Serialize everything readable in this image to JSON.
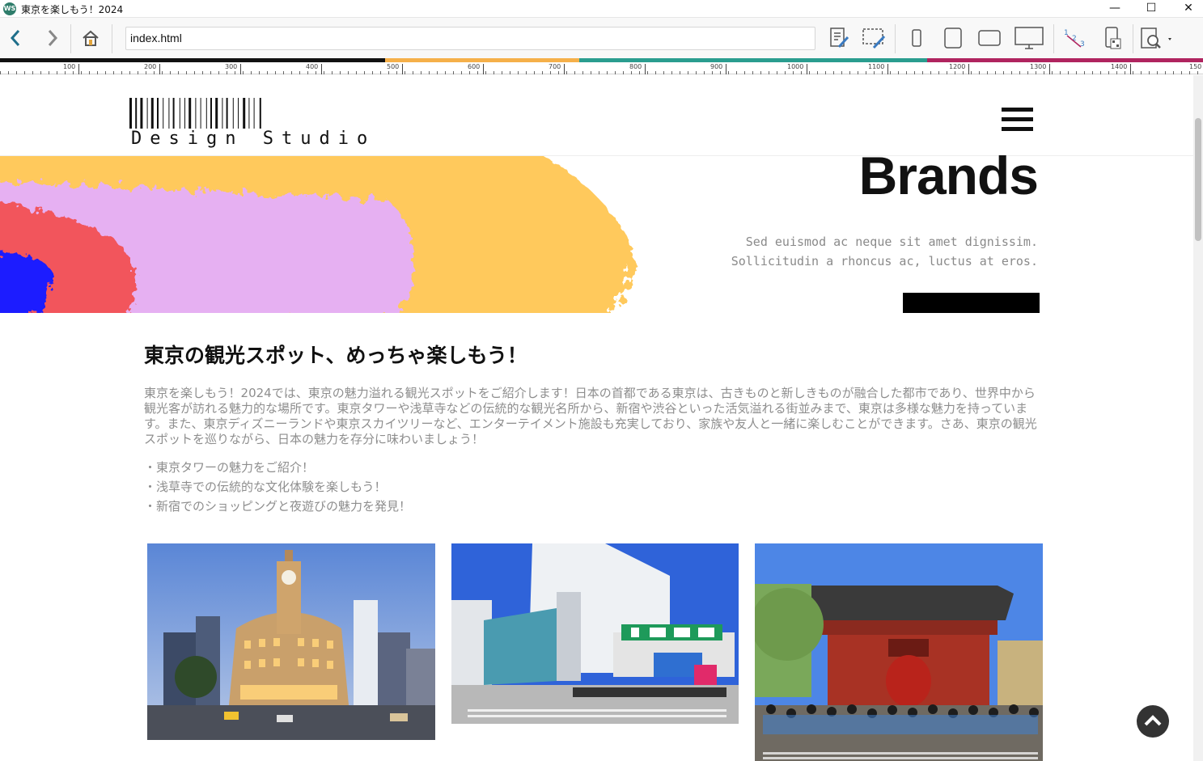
{
  "window": {
    "title": "東京を楽しもう！2024",
    "app_icon_text": "WS",
    "minimize": "—",
    "maximize": "☐",
    "close": "✕"
  },
  "toolbar": {
    "address": "index.html"
  },
  "ruler": {
    "labels": [
      "100",
      "200",
      "300",
      "400",
      "500",
      "600",
      "700",
      "800",
      "900",
      "1000",
      "1100",
      "1200",
      "1300",
      "1400",
      "150"
    ]
  },
  "colors": {
    "strip": [
      "#111111",
      "#f5b04a",
      "#2a9d8f",
      "#b0245f"
    ],
    "paint_yellow": "#ffc95c",
    "paint_pink": "#e6b0f2",
    "paint_red": "#f2545b",
    "paint_blue": "#1f1fff"
  },
  "site": {
    "logo_text": "Design Studio",
    "hero_title": "Brands",
    "hero_sub_1": "Sed euismod ac neque sit amet dignissim.",
    "hero_sub_2": "Sollicitudin a rhoncus ac, luctus at eros."
  },
  "article": {
    "heading": "東京の観光スポット、めっちゃ楽しもう！",
    "paragraph": "東京を楽しもう！2024では、東京の魅力溢れる観光スポットをご紹介します！日本の首都である東京は、古きものと新しきものが融合した都市であり、世界中から観光客が訪れる魅力的な場所です。東京タワーや浅草寺などの伝統的な観光名所から、新宿や渋谷といった活気溢れる街並みまで、東京は多様な魅力を持っています。また、東京ディズニーランドや東京スカイツリーなど、エンターテイメント施設も充実しており、家族や友人と一緒に楽しむことができます。さあ、東京の観光スポットを巡りながら、日本の魅力を存分に味わいましょう！",
    "items": [
      "・東京タワーの魅力をご紹介！",
      "・浅草寺での伝統的な文化体験を楽しもう！",
      "・新宿でのショッピングと夜遊びの魅力を発見！"
    ]
  },
  "photos": [
    {
      "name": "ginza-photo"
    },
    {
      "name": "shinjuku-station-photo"
    },
    {
      "name": "sensoji-gate-photo"
    }
  ]
}
